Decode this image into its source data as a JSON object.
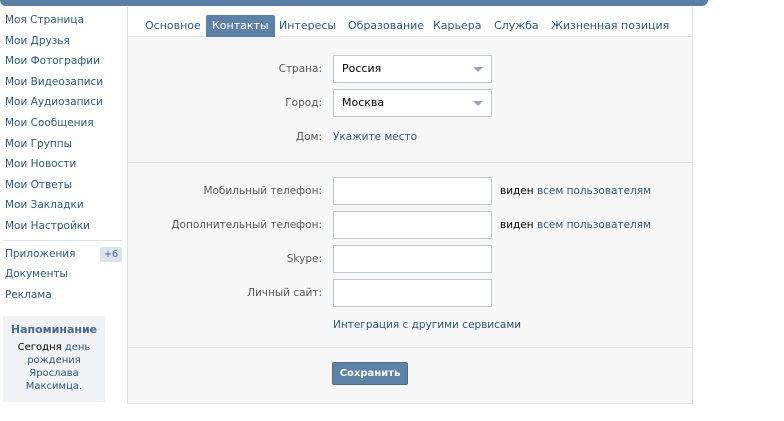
{
  "sidebar": {
    "items": [
      {
        "label": "Моя Страница"
      },
      {
        "label": "Мои Друзья"
      },
      {
        "label": "Мои Фотографии"
      },
      {
        "label": "Мои Видеозаписи"
      },
      {
        "label": "Мои Аудиозаписи"
      },
      {
        "label": "Мои Сообщения"
      },
      {
        "label": "Мои Группы"
      },
      {
        "label": "Мои Новости"
      },
      {
        "label": "Мои Ответы"
      },
      {
        "label": "Мои Закладки"
      },
      {
        "label": "Мои Настройки"
      }
    ],
    "extra": [
      {
        "label": "Приложения",
        "badge": "+6"
      },
      {
        "label": "Документы"
      },
      {
        "label": "Реклама"
      }
    ],
    "reminder": {
      "title": "Напоминание",
      "prefix": "Сегодня",
      "link": "день рождения",
      "name": "Ярослава Максимца."
    }
  },
  "tabs": [
    {
      "label": "Основное"
    },
    {
      "label": "Контакты",
      "active": true
    },
    {
      "label": "Интересы"
    },
    {
      "label": "Образование"
    },
    {
      "label": "Карьера"
    },
    {
      "label": "Служба"
    },
    {
      "label": "Жизненная позиция"
    }
  ],
  "form": {
    "country": {
      "label": "Страна:",
      "value": "Россия"
    },
    "city": {
      "label": "Город:",
      "value": "Москва"
    },
    "home": {
      "label": "Дом:",
      "link": "Укажите место"
    },
    "mobile": {
      "label": "Мобильный телефон:",
      "value": "",
      "visibility_prefix": "виден",
      "visibility_link": "всем пользователям"
    },
    "extra_phone": {
      "label": "Дополнительный телефон:",
      "value": "",
      "visibility_prefix": "виден",
      "visibility_link": "всем пользователям"
    },
    "skype": {
      "label": "Skype:",
      "value": ""
    },
    "site": {
      "label": "Личный сайт:",
      "value": ""
    },
    "integration_link": "Интеграция с другими сервисами",
    "save_label": "Сохранить"
  },
  "colors": {
    "link": "#2b587a",
    "accent": "#5e81a8",
    "panel_bg": "#f7f7f7",
    "border": "#dae1e8"
  }
}
